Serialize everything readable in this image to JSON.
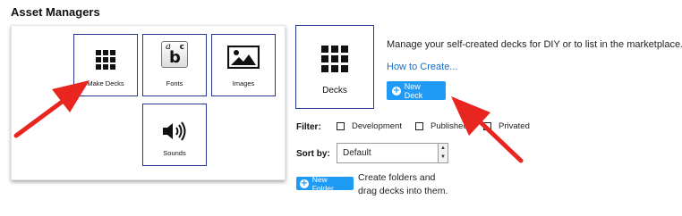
{
  "page": {
    "title": "Asset Managers"
  },
  "tiles": {
    "make_decks": "Make Decks",
    "fonts": "Fonts",
    "images": "Images",
    "sounds": "Sounds"
  },
  "fonts_icon_letters": {
    "a": "a",
    "b": "b",
    "c": "c"
  },
  "deck_card": {
    "label": "Decks",
    "description": "Manage your self-created decks for DIY or to list in the marketplace.",
    "link": "How to Create...",
    "new_deck_button": "New Deck"
  },
  "filter": {
    "label": "Filter:",
    "options": [
      "Development",
      "Published",
      "Privated"
    ]
  },
  "sort": {
    "label": "Sort by:",
    "selected": "Default"
  },
  "folder": {
    "button": "New Folder",
    "line1": "Create folders and",
    "line2": "drag decks into them."
  },
  "colors": {
    "accent": "#1f9af5",
    "tile_border": "#27378f",
    "annotation_arrow": "#e8261f"
  },
  "icons": [
    "grid-icon",
    "abc-font-icon",
    "image-icon",
    "speaker-icon",
    "plus-circle-icon",
    "red-arrow-annotation"
  ]
}
